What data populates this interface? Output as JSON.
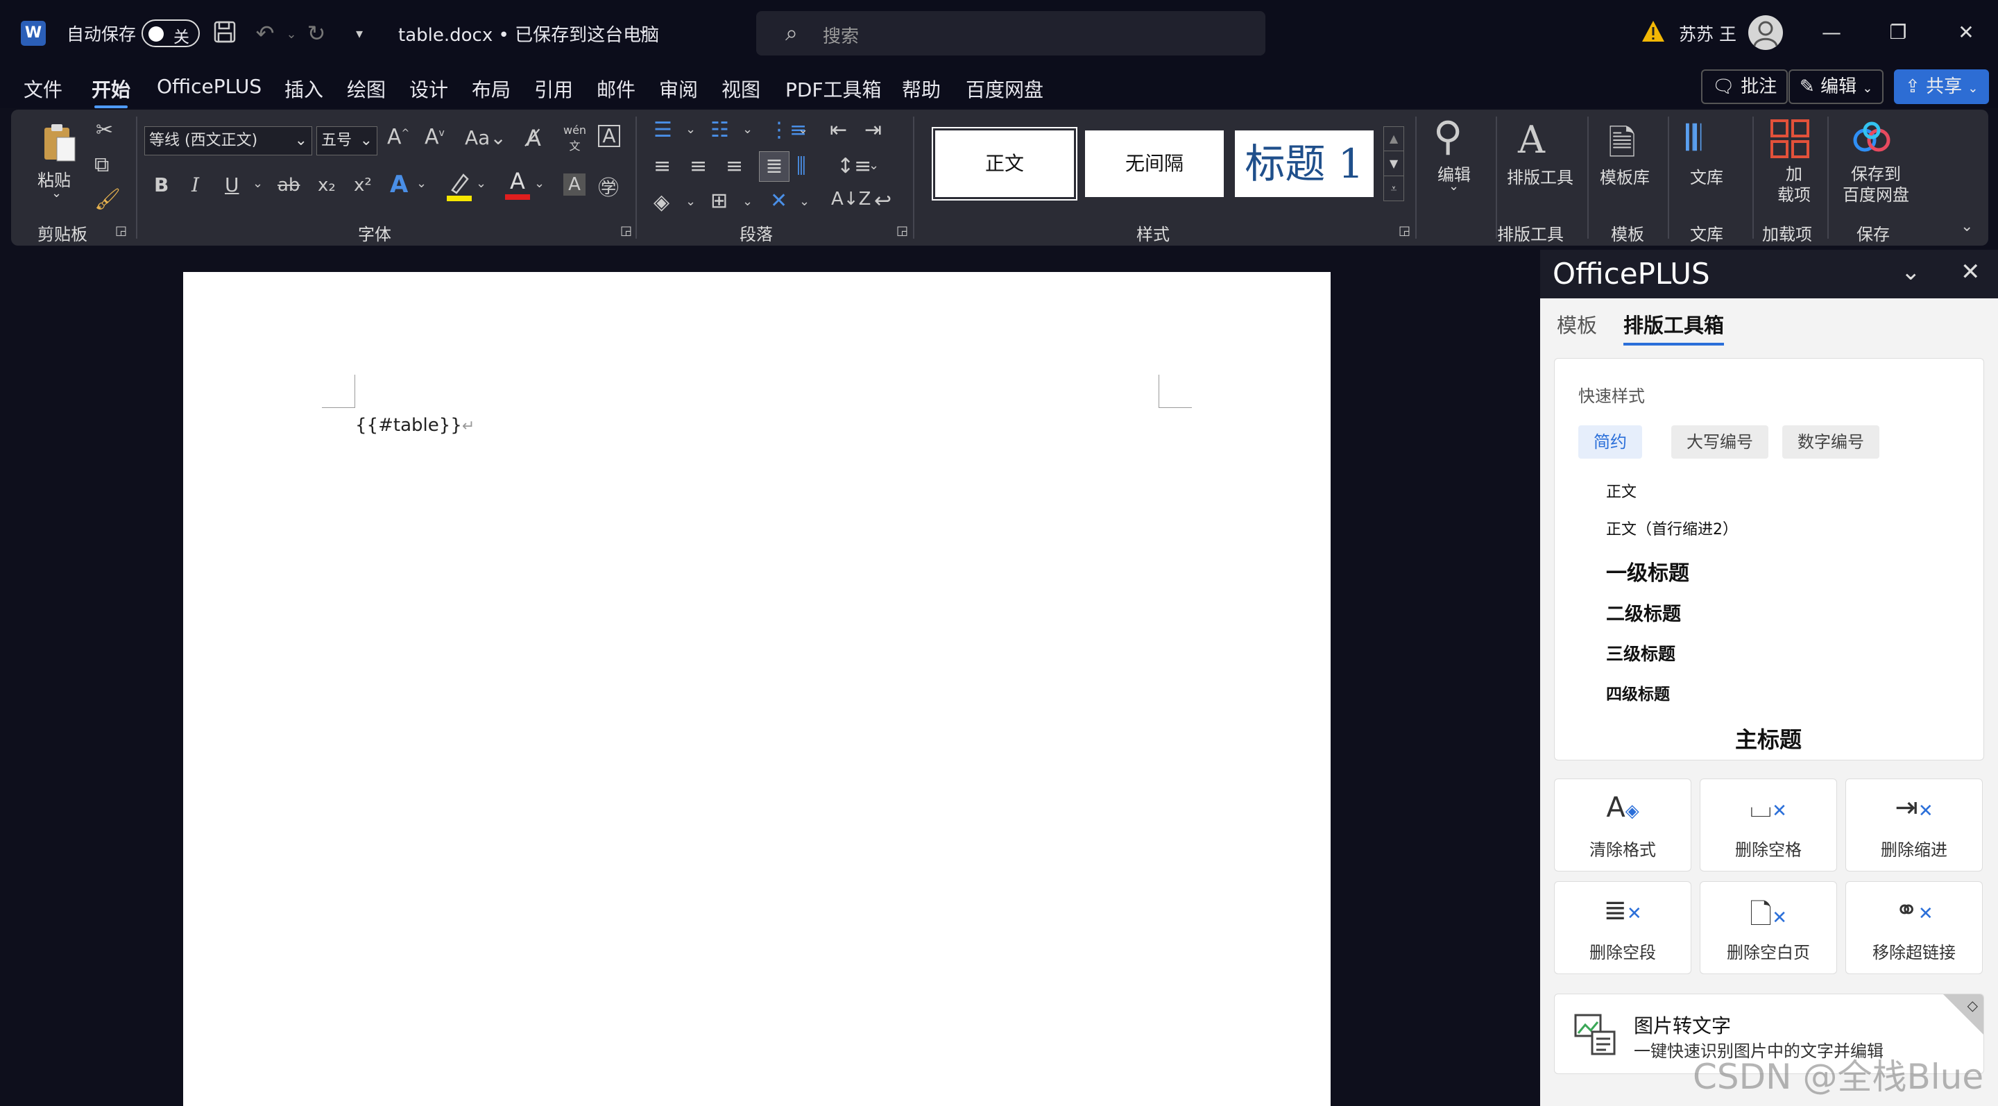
{
  "titlebar": {
    "app_logo": "W",
    "autosave_label": "自动保存",
    "autosave_state": "关",
    "filename": "table.docx • 已保存到这台电脑",
    "search_placeholder": "搜索",
    "user_name": "苏苏 王",
    "warning_color": "#f2b705"
  },
  "menu": {
    "tabs": [
      "文件",
      "开始",
      "OfficePLUS",
      "插入",
      "绘图",
      "设计",
      "布局",
      "引用",
      "邮件",
      "审阅",
      "视图",
      "PDF工具箱",
      "帮助",
      "百度网盘"
    ],
    "active_tab": "开始",
    "comment_btn": "批注",
    "edit_btn": "编辑",
    "share_btn": "共享"
  },
  "ribbon": {
    "clipboard": {
      "paste": "粘贴",
      "label": "剪贴板"
    },
    "font": {
      "font_name": "等线 (西文正文)",
      "font_size": "五号",
      "label": "字体",
      "bold": "B",
      "italic": "I",
      "underline": "U",
      "strike": "ab",
      "sub": "x₂",
      "sup": "x²",
      "phonetic": "wén",
      "aa": "Aa"
    },
    "paragraph": {
      "label": "段落"
    },
    "styles": {
      "normal": "正文",
      "no_spacing": "无间隔",
      "heading1": "标题 1",
      "label": "样式"
    },
    "editing": {
      "label": "编辑"
    },
    "layout_tool": {
      "name": "排版工具",
      "label": "排版工具"
    },
    "template": {
      "name": "模板库",
      "label": "模板"
    },
    "library": {
      "name": "文库",
      "label": "文库"
    },
    "addins": {
      "name": "加\n载项",
      "label": "加载项"
    },
    "save": {
      "name": "保存到\n百度网盘",
      "label": "保存"
    }
  },
  "document": {
    "text": "{{#table}}",
    "pilcrow": "↵"
  },
  "pane": {
    "title": "OfficePLUS",
    "tabs": [
      "模板",
      "排版工具箱"
    ],
    "active_tab": "排版工具箱",
    "quick_style_title": "快速样式",
    "chips": [
      "简约",
      "大写编号",
      "数字编号"
    ],
    "styles": [
      "正文",
      "正文（首行缩进2）",
      "一级标题",
      "二级标题",
      "三级标题",
      "四级标题",
      "主标题"
    ],
    "tools": [
      "清除格式",
      "删除空格",
      "删除缩进",
      "删除空段",
      "删除空白页",
      "移除超链接"
    ],
    "ocr_title": "图片转文字",
    "ocr_sub": "一键快速识别图片中的文字并编辑"
  },
  "watermark": "CSDN @全栈Blue"
}
